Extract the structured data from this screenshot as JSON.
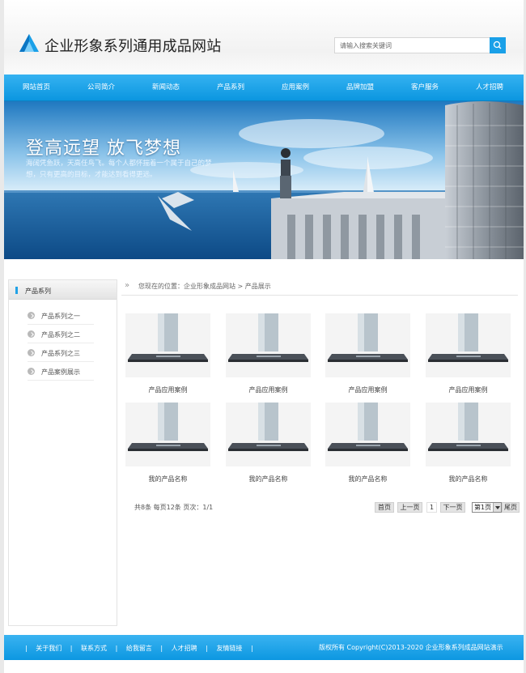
{
  "header": {
    "site_title": "企业形象系列通用成品网站",
    "search_placeholder": "请输入搜索关键词",
    "accent_color": "#1aa0e8"
  },
  "nav": {
    "items": [
      "网站首页",
      "公司简介",
      "新闻动态",
      "产品系列",
      "应用案例",
      "品牌加盟",
      "客户服务",
      "人才招聘"
    ]
  },
  "banner": {
    "slogan": "登高远望 放飞梦想",
    "subtitle": "海阔凭鱼跃，天高任鸟飞。每个人都怀揣着一个属于自己的梦想，只有更高的目标，才能达到看得更远。"
  },
  "sidebar": {
    "title": "产品系列",
    "items": [
      "产品系列之一",
      "产品系列之二",
      "产品系列之三",
      "产品案例展示"
    ]
  },
  "breadcrumb": {
    "text": "您现在的位置：企业形象成品网站 > 产品展示"
  },
  "products": {
    "row1": [
      "产品应用案例",
      "产品应用案例",
      "产品应用案例",
      "产品应用案例"
    ],
    "row2": [
      "我的产品名称",
      "我的产品名称",
      "我的产品名称",
      "我的产品名称"
    ]
  },
  "pager": {
    "info": "共8条 每页12条 页次：1/1",
    "first": "首页",
    "prev": "上一页",
    "page": "1",
    "next": "下一页",
    "select_value": "第1页",
    "last": "尾页"
  },
  "footer": {
    "links": [
      "关于我们",
      "联系方式",
      "给我留言",
      "人才招聘",
      "友情链接"
    ],
    "copyright": "版权所有 Copyright(C)2013-2020 企业形象系列成品网站演示"
  }
}
